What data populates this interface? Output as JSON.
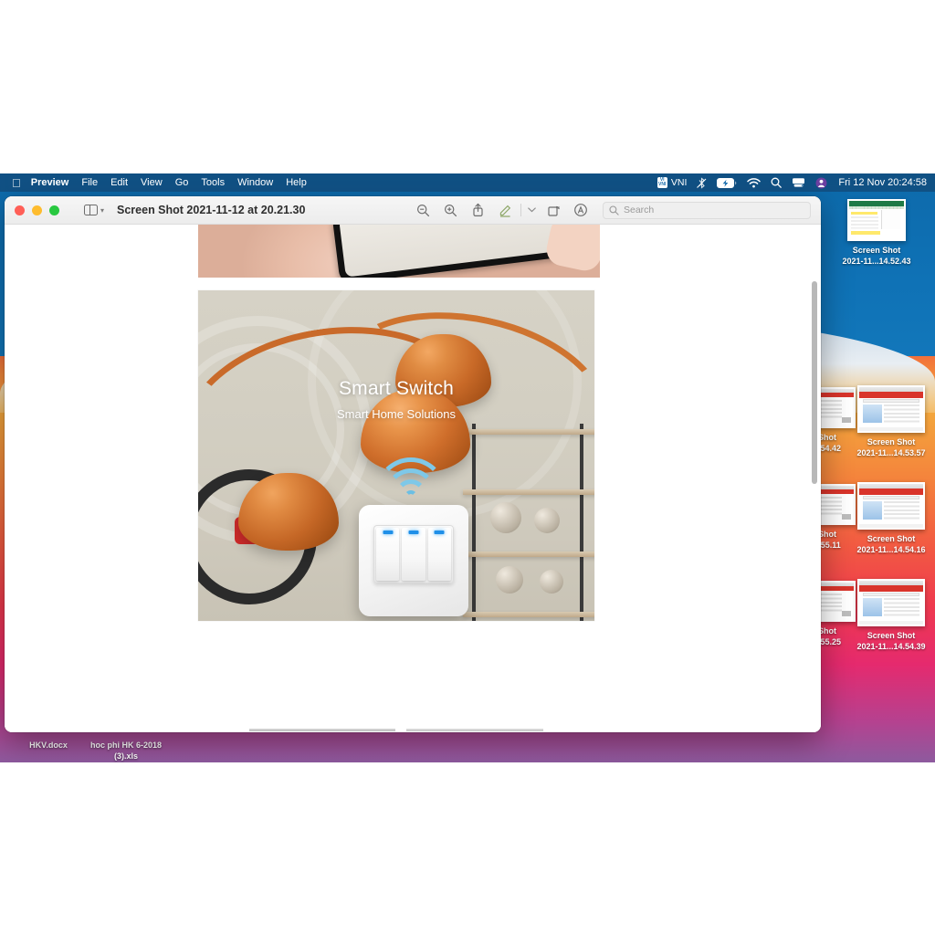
{
  "menubar": {
    "apple_icon": "apple-logo",
    "items": [
      {
        "label": "Preview",
        "bold": true
      },
      {
        "label": "File"
      },
      {
        "label": "Edit"
      },
      {
        "label": "View"
      },
      {
        "label": "Go"
      },
      {
        "label": "Tools"
      },
      {
        "label": "Window"
      },
      {
        "label": "Help"
      }
    ],
    "status": {
      "input_method_badge": "VI\nVNI",
      "input_method_label": "VNI",
      "bluetooth_icon": "bluetooth-off-icon",
      "battery_icon": "battery-charging-icon",
      "wifi_icon": "wifi-icon",
      "search_icon": "spotlight-search-icon",
      "display_icon": "screen-sharing-icon",
      "user_icon": "fast-user-switch-icon",
      "datetime": "Fri 12 Nov  20:24:58"
    }
  },
  "window": {
    "title": "Screen Shot 2021-11-12 at 20.21.30",
    "traffic_lights": [
      "close",
      "minimize",
      "zoom"
    ],
    "sidebar_toggle": "sidebar-toggle-icon",
    "toolbar": [
      {
        "name": "zoom-out-button",
        "icon": "magnifier-minus"
      },
      {
        "name": "zoom-in-button",
        "icon": "magnifier-plus"
      },
      {
        "name": "share-button",
        "icon": "share-arrow-up"
      },
      {
        "name": "markup-button",
        "icon": "pencil-underline"
      },
      {
        "name": "markup-options-button",
        "icon": "chevron-down"
      },
      {
        "name": "rotate-button",
        "icon": "rotate-left"
      },
      {
        "name": "annotate-button",
        "icon": "circle-a"
      }
    ],
    "search": {
      "placeholder": "Search",
      "value": "",
      "icon": "search-icon"
    }
  },
  "document": {
    "image_caption_title": "Smart Switch",
    "image_caption_subtitle": "Smart Home Solutions",
    "switch_gangs": 3,
    "led_color": "#1f8fe8"
  },
  "desktop": {
    "icons": [
      {
        "name": "Screen Shot",
        "line2": "2021-11...14.52.43",
        "thumb": "sheet"
      },
      {
        "name": "Shot",
        "line2": "4.54.42",
        "thumb": "doc",
        "clipped": true
      },
      {
        "name": "Screen Shot",
        "line2": "2021-11...14.53.57",
        "thumb": "web"
      },
      {
        "name": "Shot",
        "line2": "4.55.11",
        "thumb": "doc",
        "clipped": true
      },
      {
        "name": "Screen Shot",
        "line2": "2021-11...14.54.16",
        "thumb": "web"
      },
      {
        "name": "Shot",
        "line2": "4.55.25",
        "thumb": "doc",
        "clipped": true
      },
      {
        "name": "Screen Shot",
        "line2": "2021-11...14.54.39",
        "thumb": "web"
      }
    ],
    "bottom_files": [
      {
        "label": "HKV.docx"
      },
      {
        "label": "hoc phi HK 6-2018",
        "line2": "(3).xls"
      }
    ]
  },
  "colors": {
    "accent_blue": "#1f8fe8",
    "menubar": "rgba(20,60,100,0.55)",
    "window_chrome": "#f0f0f0",
    "wallpaper_top": "#0d6aab",
    "wallpaper_warm": "#f3a63c"
  }
}
